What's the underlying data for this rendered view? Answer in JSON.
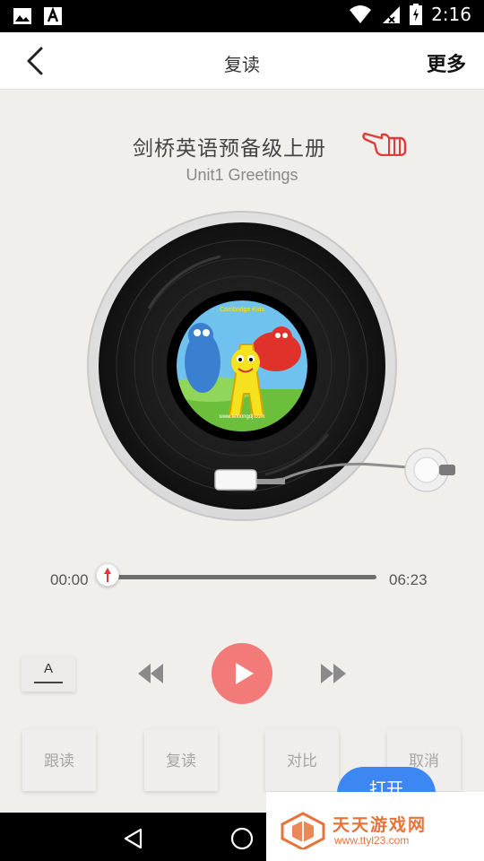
{
  "status_bar": {
    "time": "2:16",
    "icons": [
      "image-icon",
      "text-a-icon",
      "wifi-icon",
      "signal-icon",
      "battery-icon"
    ]
  },
  "header": {
    "back_icon": "chevron-left-icon",
    "title": "复读",
    "more_label": "更多"
  },
  "book": {
    "title": "剑桥英语预备级上册",
    "unit": "Unit1 Greetings",
    "pointer_icon": "pointing-hand-icon"
  },
  "record_label_text": {
    "top": "Cambridge Kids",
    "bottom": "www.lexiongdj.com"
  },
  "player": {
    "current_time": "00:00",
    "total_time": "06:23",
    "progress": 0,
    "font_button_label": "A",
    "controls": [
      "rewind-icon",
      "play-icon",
      "fast-forward-icon"
    ]
  },
  "modes": {
    "follow": "跟读",
    "repeat": "复读",
    "compare": "对比",
    "cancel": "取消"
  },
  "open_button": "打开",
  "watermark": {
    "name": "天天游戏网",
    "url": "www.ttyl23.com"
  },
  "colors": {
    "play_button": "#f27a79",
    "accent_red": "#e23a3a",
    "open_button": "#3d87f3",
    "watermark": "#e8733a"
  }
}
